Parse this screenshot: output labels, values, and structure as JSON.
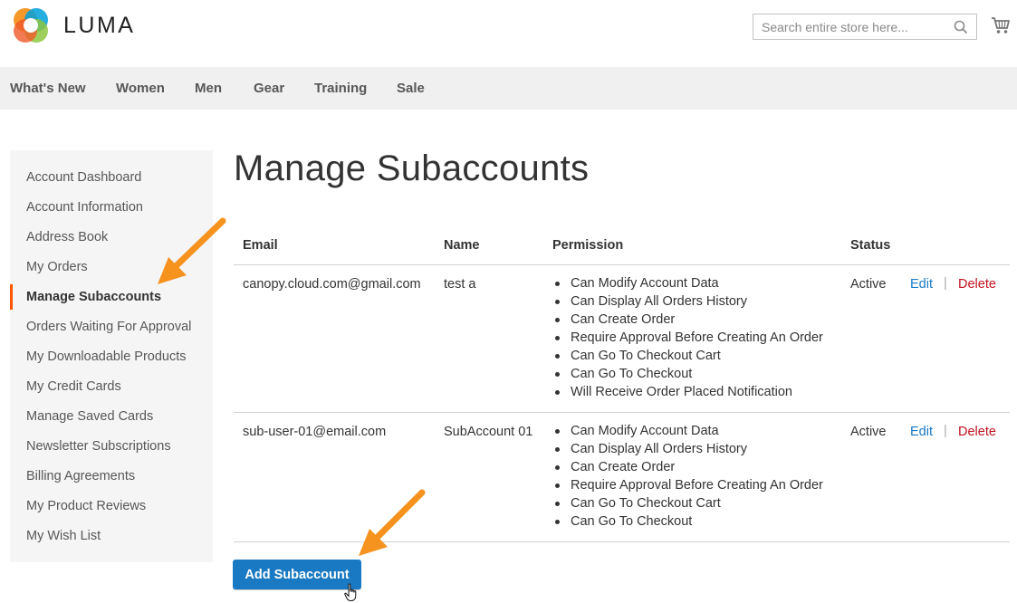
{
  "header": {
    "brand": "LUMA",
    "search_placeholder": "Search entire store here..."
  },
  "nav": {
    "items": [
      "What's New",
      "Women",
      "Men",
      "Gear",
      "Training",
      "Sale"
    ]
  },
  "sidebar": {
    "items": [
      "Account Dashboard",
      "Account Information",
      "Address Book",
      "My Orders",
      "Manage Subaccounts",
      "Orders Waiting For Approval",
      "My Downloadable Products",
      "My Credit Cards",
      "Manage Saved Cards",
      "Newsletter Subscriptions",
      "Billing Agreements",
      "My Product Reviews",
      "My Wish List"
    ],
    "active": "Manage Subaccounts"
  },
  "page": {
    "title": "Manage Subaccounts",
    "add_button": "Add Subaccount"
  },
  "table": {
    "headers": {
      "email": "Email",
      "name": "Name",
      "permission": "Permission",
      "status": "Status"
    },
    "rows": [
      {
        "email": "canopy.cloud.com@gmail.com",
        "name": "test a",
        "permissions": [
          "Can Modify Account Data",
          "Can Display All Orders History",
          "Can Create Order",
          "Require Approval Before Creating An Order",
          "Can Go To Checkout Cart",
          "Can Go To Checkout",
          "Will Receive Order Placed Notification"
        ],
        "status": "Active",
        "edit": "Edit",
        "separator": "|",
        "delete": "Delete"
      },
      {
        "email": "sub-user-01@email.com",
        "name": "SubAccount 01",
        "permissions": [
          "Can Modify Account Data",
          "Can Display All Orders History",
          "Can Create Order",
          "Require Approval Before Creating An Order",
          "Can Go To Checkout Cart",
          "Can Go To Checkout"
        ],
        "status": "Active",
        "edit": "Edit",
        "separator": "|",
        "delete": "Delete"
      }
    ]
  },
  "colors": {
    "accent_blue": "#1979c3",
    "delete_red": "#c0121f",
    "annotation_orange": "#f6921e",
    "active_marker": "#ff5501",
    "nav_bg": "#f0f0f0",
    "sidebar_bg": "#f5f5f5"
  },
  "icons": [
    "luma-logo-icon",
    "search-icon",
    "cart-icon",
    "hand-cursor-icon",
    "annotation-arrow-icon"
  ]
}
